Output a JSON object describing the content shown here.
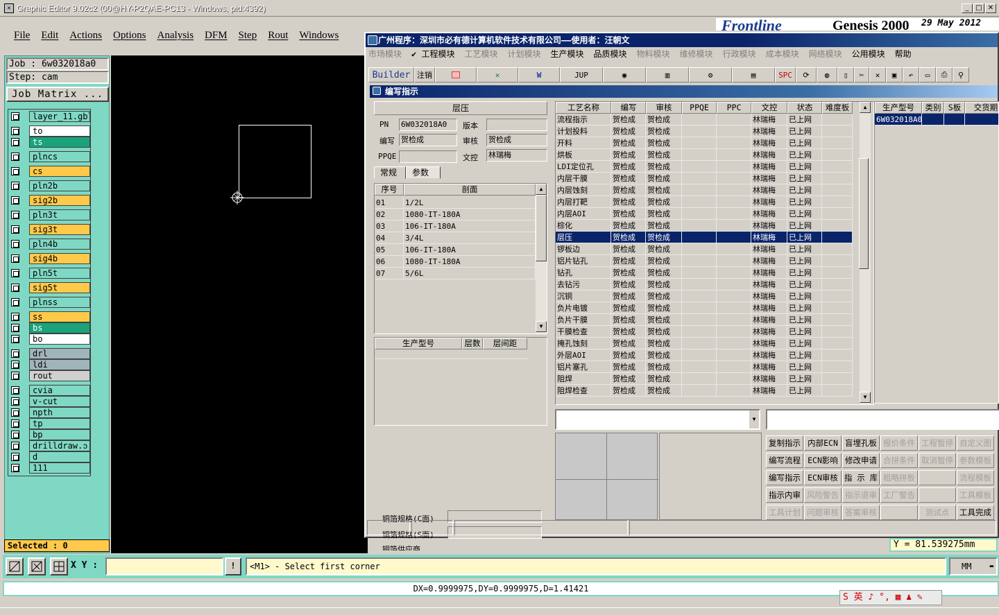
{
  "app": {
    "title": "Graphic Editor 9.02c2 (00@HY-P2QAE-PC13 - Windows, pid:4392)",
    "icon": "app-x-icon"
  },
  "menu": [
    "File",
    "Edit",
    "Actions",
    "Options",
    "Analysis",
    "DFM",
    "Step",
    "Rout",
    "Windows"
  ],
  "job": {
    "job_line": "Job  : 6w032018a0",
    "step_line": "Step: cam",
    "matrix_label": "Job Matrix ..."
  },
  "layers": [
    {
      "name": "layer_11.gbl",
      "color": "#7fd8c4"
    },
    {
      "name": "to",
      "color": "#ffffff"
    },
    {
      "name": "ts",
      "color": "#1aa37a"
    },
    {
      "name": "plncs",
      "color": "#7fd8c4"
    },
    {
      "name": "cs",
      "color": "#ffc94a"
    },
    {
      "name": "pln2b",
      "color": "#7fd8c4"
    },
    {
      "name": "sig2b",
      "color": "#ffc94a"
    },
    {
      "name": "pln3t",
      "color": "#7fd8c4"
    },
    {
      "name": "sig3t",
      "color": "#ffc94a"
    },
    {
      "name": "pln4b",
      "color": "#7fd8c4"
    },
    {
      "name": "sig4b",
      "color": "#ffc94a"
    },
    {
      "name": "pln5t",
      "color": "#7fd8c4"
    },
    {
      "name": "sig5t",
      "color": "#ffc94a"
    },
    {
      "name": "plnss",
      "color": "#7fd8c4"
    },
    {
      "name": "ss",
      "color": "#ffc94a"
    },
    {
      "name": "bs",
      "color": "#1aa37a"
    },
    {
      "name": "bo",
      "color": "#ffffff"
    },
    {
      "name": "drl",
      "color": "#a0b4bc"
    },
    {
      "name": "ldi",
      "color": "#a0b4bc"
    },
    {
      "name": "rout",
      "color": "#d0d0d0"
    },
    {
      "name": "cvia",
      "color": "#7fd8c4"
    },
    {
      "name": "v-cut",
      "color": "#7fd8c4"
    },
    {
      "name": "npth",
      "color": "#7fd8c4"
    },
    {
      "name": "tp",
      "color": "#7fd8c4"
    },
    {
      "name": "bp",
      "color": "#7fd8c4"
    },
    {
      "name": "drilldraw.ↄ",
      "color": "#7fd8c4"
    },
    {
      "name": "d",
      "color": "#7fd8c4"
    },
    {
      "name": "111",
      "color": "#7fd8c4"
    }
  ],
  "selected": "Selected : 0",
  "cmd": {
    "xy_label": "X Y :",
    "xy_value": "",
    "message": "<M1> - Select first corner",
    "unit": "MM",
    "info_btn": "!"
  },
  "status": "DX=0.9999975,DY=0.9999975,D=1.41421",
  "y_readout": "Y  =  81.539275mm",
  "genesis": {
    "brand": "Frontline",
    "product": "Genesis 2000",
    "date": "29 May 2012"
  },
  "ime": "S 英 ♪ °, ▦ ♟ ✎",
  "mis": {
    "title": "广州程序：深圳市必有德计算机软件技术有限公司——使用者：汪朝文",
    "menu": [
      {
        "label": "市场模块",
        "enabled": false
      },
      {
        "label": "✔ 工程模块",
        "enabled": true
      },
      {
        "label": "工艺模块",
        "enabled": false
      },
      {
        "label": "计划模块",
        "enabled": false
      },
      {
        "label": "生产模块",
        "enabled": true
      },
      {
        "label": "品质模块",
        "enabled": true
      },
      {
        "label": "物料模块",
        "enabled": false
      },
      {
        "label": "维修模块",
        "enabled": false
      },
      {
        "label": "行政模块",
        "enabled": false
      },
      {
        "label": "成本模块",
        "enabled": false
      },
      {
        "label": "网络模块",
        "enabled": false
      },
      {
        "label": "公用模块",
        "enabled": true
      },
      {
        "label": "帮助",
        "enabled": true
      }
    ],
    "toolbar": {
      "builder": "Builder",
      "logout": "注销",
      "jup": "JUP",
      "spc": "SPC"
    },
    "sub_title": "编写指示",
    "info": {
      "heading": "层压",
      "pn_label": "PN",
      "pn": "6W032018A0",
      "version_label": "版本",
      "version": "",
      "writer_label": "编写",
      "writer": "贺检成",
      "review_label": "审核",
      "review": "贺检成",
      "ppqe_label": "PPQE",
      "ppqe": "",
      "doc_label": "文控",
      "doc": "林瑞梅",
      "tab_general": "常规",
      "tab_params": "参数"
    },
    "stack": {
      "headers": [
        "序号",
        "剖面"
      ],
      "rows": [
        [
          "01",
          "1/2L"
        ],
        [
          "02",
          "1080-IT-180A"
        ],
        [
          "03",
          "106-IT-180A"
        ],
        [
          "04",
          "3/4L"
        ],
        [
          "05",
          "106-IT-180A"
        ],
        [
          "06",
          "1080-IT-180A"
        ],
        [
          "07",
          "5/6L"
        ]
      ]
    },
    "model_table": {
      "headers": [
        "生产型号",
        "层数",
        "层间距"
      ]
    },
    "foil": {
      "c_label": "铜箔规格(C面)",
      "s_label": "铜箔规格(S面)",
      "supplier_label": "铜箔供应商"
    },
    "process": {
      "headers": [
        "工艺名称",
        "编写",
        "审核",
        "PPQE",
        "PPC",
        "文控",
        "状态",
        "难度板"
      ],
      "rows": [
        [
          "流程指示",
          "贺检成",
          "贺检成",
          "",
          "",
          "林瑞梅",
          "已上网",
          ""
        ],
        [
          "计划投料",
          "贺检成",
          "贺检成",
          "",
          "",
          "林瑞梅",
          "已上网",
          ""
        ],
        [
          "开料",
          "贺检成",
          "贺检成",
          "",
          "",
          "林瑞梅",
          "已上网",
          ""
        ],
        [
          "烘板",
          "贺检成",
          "贺检成",
          "",
          "",
          "林瑞梅",
          "已上网",
          ""
        ],
        [
          "LDI定位孔",
          "贺检成",
          "贺检成",
          "",
          "",
          "林瑞梅",
          "已上网",
          ""
        ],
        [
          "内层干膜",
          "贺检成",
          "贺检成",
          "",
          "",
          "林瑞梅",
          "已上网",
          ""
        ],
        [
          "内层蚀刻",
          "贺检成",
          "贺检成",
          "",
          "",
          "林瑞梅",
          "已上网",
          ""
        ],
        [
          "内层打靶",
          "贺检成",
          "贺检成",
          "",
          "",
          "林瑞梅",
          "已上网",
          ""
        ],
        [
          "内层AOI",
          "贺检成",
          "贺检成",
          "",
          "",
          "林瑞梅",
          "已上网",
          ""
        ],
        [
          "棕化",
          "贺检成",
          "贺检成",
          "",
          "",
          "林瑞梅",
          "已上网",
          ""
        ],
        [
          "层压",
          "贺检成",
          "贺检成",
          "",
          "",
          "林瑞梅",
          "已上网",
          ""
        ],
        [
          "锣板边",
          "贺检成",
          "贺检成",
          "",
          "",
          "林瑞梅",
          "已上网",
          ""
        ],
        [
          "铝片钻孔",
          "贺检成",
          "贺检成",
          "",
          "",
          "林瑞梅",
          "已上网",
          ""
        ],
        [
          "钻孔",
          "贺检成",
          "贺检成",
          "",
          "",
          "林瑞梅",
          "已上网",
          ""
        ],
        [
          "去钻污",
          "贺检成",
          "贺检成",
          "",
          "",
          "林瑞梅",
          "已上网",
          ""
        ],
        [
          "沉铜",
          "贺检成",
          "贺检成",
          "",
          "",
          "林瑞梅",
          "已上网",
          ""
        ],
        [
          "负片电镀",
          "贺检成",
          "贺检成",
          "",
          "",
          "林瑞梅",
          "已上网",
          ""
        ],
        [
          "负片干膜",
          "贺检成",
          "贺检成",
          "",
          "",
          "林瑞梅",
          "已上网",
          ""
        ],
        [
          "干膜检查",
          "贺检成",
          "贺检成",
          "",
          "",
          "林瑞梅",
          "已上网",
          ""
        ],
        [
          "掩孔蚀刻",
          "贺检成",
          "贺检成",
          "",
          "",
          "林瑞梅",
          "已上网",
          ""
        ],
        [
          "外层AOI",
          "贺检成",
          "贺检成",
          "",
          "",
          "林瑞梅",
          "已上网",
          ""
        ],
        [
          "铝片塞孔",
          "贺检成",
          "贺检成",
          "",
          "",
          "林瑞梅",
          "已上网",
          ""
        ],
        [
          "阻焊",
          "贺检成",
          "贺检成",
          "",
          "",
          "林瑞梅",
          "已上网",
          ""
        ],
        [
          "阻焊检查",
          "贺检成",
          "贺检成",
          "",
          "",
          "林瑞梅",
          "已上网",
          ""
        ]
      ],
      "selected_index": 10
    },
    "right_table": {
      "headers": [
        "生产型号",
        "类别",
        "S板",
        "交货期"
      ],
      "rows": [
        [
          "6W032018A0",
          "",
          "",
          ""
        ]
      ]
    },
    "buttons": [
      [
        {
          "label": "复制指示",
          "enabled": true
        },
        {
          "label": "内部ECN",
          "enabled": true
        },
        {
          "label": "盲埋孔板",
          "enabled": true
        },
        {
          "label": "报价条件",
          "enabled": false
        },
        {
          "label": "工程暂停",
          "enabled": false
        },
        {
          "label": "自定义图",
          "enabled": false
        }
      ],
      [
        {
          "label": "编写流程",
          "enabled": true
        },
        {
          "label": "ECN影响",
          "enabled": true
        },
        {
          "label": "修改申请",
          "enabled": true
        },
        {
          "label": "合拼条件",
          "enabled": false
        },
        {
          "label": "取消暂停",
          "enabled": false
        },
        {
          "label": "参数模板",
          "enabled": false
        }
      ],
      [
        {
          "label": "编写指示",
          "enabled": true
        },
        {
          "label": "ECN审核",
          "enabled": true
        },
        {
          "label": "指 示 库",
          "enabled": true
        },
        {
          "label": "粗略拼板",
          "enabled": false
        },
        {
          "label": "",
          "enabled": false
        },
        {
          "label": "流程模板",
          "enabled": false
        }
      ],
      [
        {
          "label": "指示内审",
          "enabled": true
        },
        {
          "label": "风险警告",
          "enabled": false
        },
        {
          "label": "指示退审",
          "enabled": false
        },
        {
          "label": "工厂警告",
          "enabled": false
        },
        {
          "label": "",
          "enabled": false
        },
        {
          "label": "工具模板",
          "enabled": false
        }
      ],
      [
        {
          "label": "工具计划",
          "enabled": false
        },
        {
          "label": "问题审核",
          "enabled": false
        },
        {
          "label": "答案审核",
          "enabled": false
        },
        {
          "label": "",
          "enabled": false
        },
        {
          "label": "测试点",
          "enabled": false
        },
        {
          "label": "工具完成",
          "enabled": true
        }
      ]
    ]
  }
}
